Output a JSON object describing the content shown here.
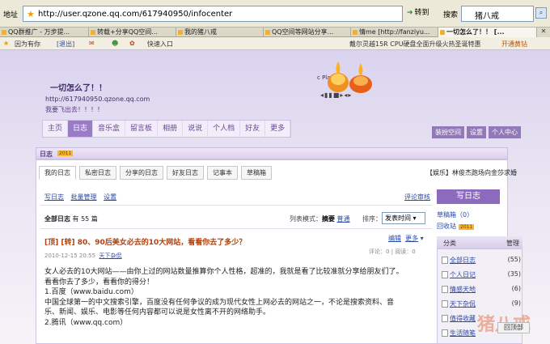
{
  "browser": {
    "address_label": "地址",
    "url": "http://user.qzone.qq.com/617940950/infocenter",
    "go_label": "转到",
    "search_label": "搜索",
    "search_value": "猪八戒",
    "tabs": [
      "QQ群推广 - 万步提...",
      "转载+分享QQ空间...",
      "我的猪八戒",
      "QQ空间等网站分享...",
      "情me [http://fanziyu...",
      "一切怎么了！！ [..."
    ],
    "quick": {
      "user": "因为有你",
      "logout": "[退出]",
      "quick_entry": "快速入口",
      "news": "戴尔灵越15R CPU硬盘全面升级火热圣诞特惠",
      "open_vip": "开通黄钻"
    }
  },
  "space": {
    "title": "一切怎么了！！",
    "url": "http://617940950.qzone.qq.com",
    "motto": "我要飞出去！！！！",
    "player_label": "c Player",
    "nav": [
      "主页",
      "日志",
      "音乐盒",
      "留言板",
      "相册",
      "说说",
      "个人档",
      "好友",
      "更多"
    ],
    "right_nav": [
      "装扮空间",
      "设置",
      "个人中心"
    ]
  },
  "blog": {
    "section_title": "日志",
    "section_badge": "2011",
    "subtabs": [
      "我的日志",
      "私密日志",
      "分享的日志",
      "好友日志",
      "记事本",
      "草稿箱"
    ],
    "ad": "【娱乐】林俊杰跑场向金莎求婚",
    "links": [
      "写日志",
      "批量管理",
      "设置"
    ],
    "config": "评论审核",
    "count_label": "全部日志",
    "count_value": "有 55 篇",
    "mode_label": "列表模式：",
    "mode_summary": "摘要",
    "mode_normal": "普通",
    "sort_label": "排序：",
    "sort_value": "发表时间",
    "post": {
      "title": "[顶] [转] 80、90后美女必去的10大网站，看看你去了多少？",
      "edit": "编辑",
      "more": "更多",
      "date": "2010-12-15 20:55",
      "category": "天下杂侃",
      "comments": "评论：0",
      "reads": "阅读：0",
      "body": [
        "女人必去的10大网站——由你上过的网站数量推算你个人性格，超准的，我就是看了比较准就分享给朋友们了。",
        "看看你去了多少，看看你的得分！",
        "1.百度（www.baidu.com）",
        "中国全球第一的中文搜索引擎，百度没有任何争议的成为现代女性上网必去的网站之一，不论是搜索资料、音",
        "乐、新闻、娱乐、电影等任何内容都可以说是女性离不开的网络助手。",
        "2.腾讯（www.qq.com）"
      ]
    }
  },
  "sidebar": {
    "write": "写日志",
    "draft": "草稿箱（0）",
    "recycle": "回收站",
    "recycle_badge": "2011",
    "cat_head": "分类",
    "cat_manage": "管理",
    "categories": [
      {
        "name": "全部日志",
        "count": "(55)"
      },
      {
        "name": "个人日记",
        "count": "(35)"
      },
      {
        "name": "情感天地",
        "count": "(6)"
      },
      {
        "name": "天下杂侃",
        "count": "(9)"
      },
      {
        "name": "值得收藏",
        "count": ""
      },
      {
        "name": "生活随笔",
        "count": ""
      }
    ],
    "home_button": "回顶部"
  },
  "watermark": "猪八戒"
}
